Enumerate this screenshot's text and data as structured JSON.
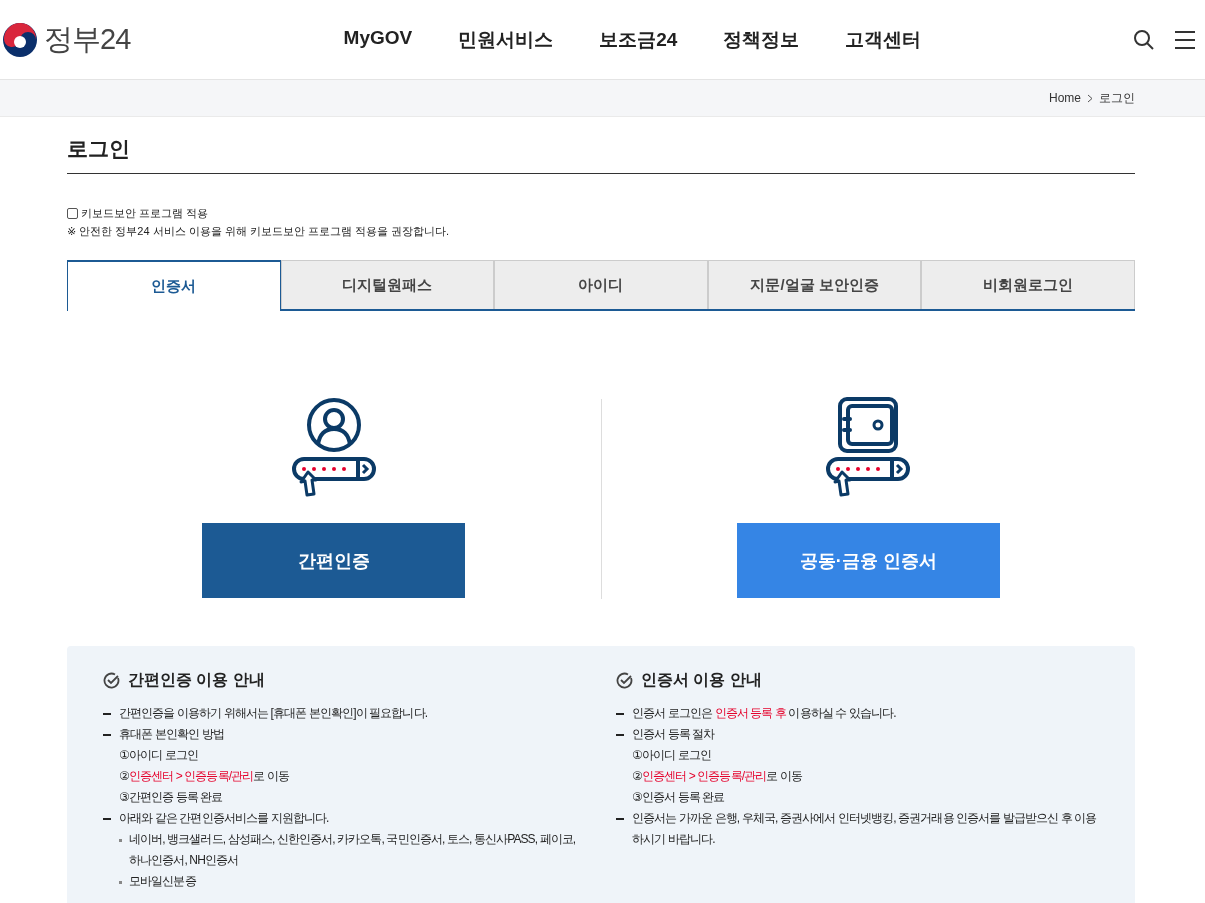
{
  "header": {
    "logo_text": "정부24",
    "nav": [
      "MyGOV",
      "민원서비스",
      "보조금24",
      "정책정보",
      "고객센터"
    ]
  },
  "breadcrumb": [
    "Home",
    "로그인"
  ],
  "page_title": "로그인",
  "keyboard_security": {
    "label": "키보드보안 프로그램 적용",
    "checked": false,
    "note": "※ 안전한 정부24 서비스 이용을 위해 키보드보안 프로그램 적용을 권장합니다."
  },
  "tabs": [
    {
      "label": "인증서",
      "selected": true
    },
    {
      "label": "디지털원패스",
      "selected": false
    },
    {
      "label": "아이디",
      "selected": false
    },
    {
      "label": "지문/얼굴 보안인증",
      "selected": false
    },
    {
      "label": "비회원로그인",
      "selected": false
    }
  ],
  "options": [
    {
      "kind": "person",
      "button": "간편인증",
      "color": "#1c5a94"
    },
    {
      "kind": "safe",
      "button": "공동·금융 인증서",
      "color": "#3585e5"
    }
  ],
  "guides": [
    {
      "title": "간편인증 이용 안내",
      "lines": [
        {
          "kind": "dash",
          "parts": [
            {
              "text": "간편인증을 이용하기 위해서는 [휴대폰 본인확인]이 필요합니다.",
              "highlight": false
            }
          ]
        },
        {
          "kind": "dash",
          "parts": [
            {
              "text": "휴대폰 본인확인 방법",
              "highlight": false
            }
          ]
        },
        {
          "kind": "step",
          "parts": [
            {
              "text": "①아이디 로그인",
              "highlight": false
            }
          ]
        },
        {
          "kind": "step",
          "parts": [
            {
              "text": "②",
              "highlight": false
            },
            {
              "text": "인증센터 > 인증등록/관리",
              "highlight": true
            },
            {
              "text": "로 이동",
              "highlight": false
            }
          ]
        },
        {
          "kind": "step",
          "parts": [
            {
              "text": "③간편인증 등록 완료",
              "highlight": false
            }
          ]
        },
        {
          "kind": "dash",
          "parts": [
            {
              "text": "아래와 같은 간편인증서비스를 지원합니다.",
              "highlight": false
            }
          ]
        },
        {
          "kind": "bullet",
          "parts": [
            {
              "text": "네이버, 뱅크샐러드, 삼성패스, 신한인증서, 카카오톡, 국민인증서, 토스, 통신사PASS, 페이코, 하나인증서, NH인증서",
              "highlight": false
            }
          ]
        },
        {
          "kind": "bullet",
          "parts": [
            {
              "text": "모바일신분증",
              "highlight": false
            }
          ]
        }
      ]
    },
    {
      "title": "인증서 이용 안내",
      "lines": [
        {
          "kind": "dash",
          "parts": [
            {
              "text": "인증서 로그인은 ",
              "highlight": false
            },
            {
              "text": "인증서 등록 후",
              "highlight": true
            },
            {
              "text": " 이용하실 수 있습니다.",
              "highlight": false
            }
          ]
        },
        {
          "kind": "dash",
          "parts": [
            {
              "text": "인증서 등록 절차",
              "highlight": false
            }
          ]
        },
        {
          "kind": "step",
          "parts": [
            {
              "text": "①아이디 로그인",
              "highlight": false
            }
          ]
        },
        {
          "kind": "step",
          "parts": [
            {
              "text": "②",
              "highlight": false
            },
            {
              "text": "인증센터 > 인증등록/관리",
              "highlight": true
            },
            {
              "text": "로 이동",
              "highlight": false
            }
          ]
        },
        {
          "kind": "step",
          "parts": [
            {
              "text": "③인증서 등록 완료",
              "highlight": false
            }
          ]
        },
        {
          "kind": "dash",
          "parts": [
            {
              "text": "인증서는 가까운 은행, 우체국, 증권사에서 인터넷뱅킹, 증권거래용 인증서를 발급받으신 후 이용하시기 바랍니다.",
              "highlight": false
            }
          ]
        }
      ]
    }
  ]
}
